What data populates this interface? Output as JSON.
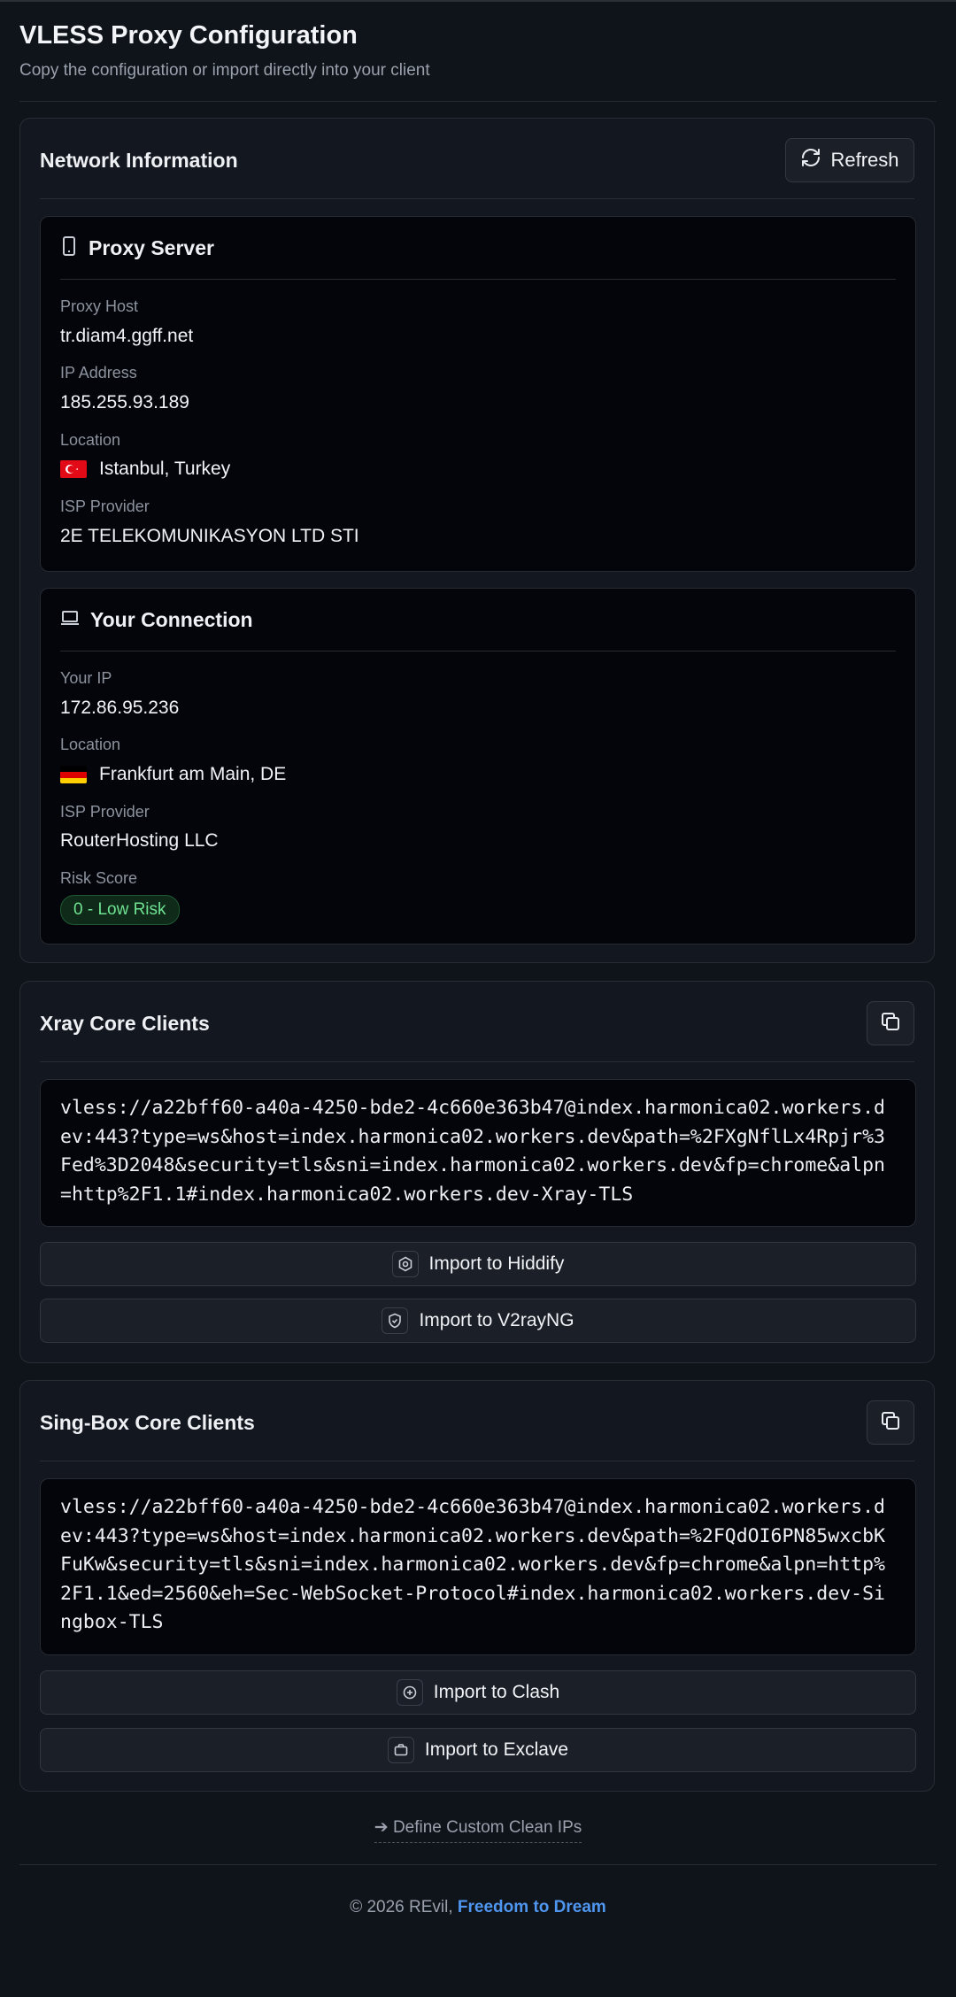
{
  "header": {
    "title": "VLESS Proxy Configuration",
    "subtitle": "Copy the configuration or import directly into your client"
  },
  "network": {
    "title": "Network Information",
    "refresh_label": "Refresh",
    "proxy": {
      "title": "Proxy Server",
      "host_label": "Proxy Host",
      "host": "tr.diam4.ggff.net",
      "ip_label": "IP Address",
      "ip": "185.255.93.189",
      "location_label": "Location",
      "location": "Istanbul, Turkey",
      "isp_label": "ISP Provider",
      "isp": "2E TELEKOMUNIKASYON LTD STI"
    },
    "connection": {
      "title": "Your Connection",
      "ip_label": "Your IP",
      "ip": "172.86.95.236",
      "location_label": "Location",
      "location": "Frankfurt am Main, DE",
      "isp_label": "ISP Provider",
      "isp": "RouterHosting LLC",
      "risk_label": "Risk Score",
      "risk": "0 - Low Risk"
    }
  },
  "xray": {
    "title": "Xray Core Clients",
    "config": "vless://a22bff60-a40a-4250-bde2-4c660e363b47@index.harmonica02.workers.dev:443?type=ws&host=index.harmonica02.workers.dev&path=%2FXgNflLx4Rpjr%3Fed%3D2048&security=tls&sni=index.harmonica02.workers.dev&fp=chrome&alpn=http%2F1.1#index.harmonica02.workers.dev-Xray-TLS",
    "import_hiddify": "Import to Hiddify",
    "import_v2rayng": "Import to V2rayNG"
  },
  "singbox": {
    "title": "Sing-Box Core Clients",
    "config": "vless://a22bff60-a40a-4250-bde2-4c660e363b47@index.harmonica02.workers.dev:443?type=ws&host=index.harmonica02.workers.dev&path=%2FQdOI6PN85wxcbKFuKw&security=tls&sni=index.harmonica02.workers.dev&fp=chrome&alpn=http%2F1.1&ed=2560&eh=Sec-WebSocket-Protocol#index.harmonica02.workers.dev-Singbox-TLS",
    "import_clash": "Import to Clash",
    "import_exclave": "Import to Exclave"
  },
  "custom_ips": "Define Custom Clean IPs",
  "footer": {
    "copyright": "© 2026 REvil,",
    "link": "Freedom to Dream"
  },
  "colors": {
    "accent": "#4f96f0",
    "risk_ok": "#6ee292",
    "background": "#0f131a"
  }
}
